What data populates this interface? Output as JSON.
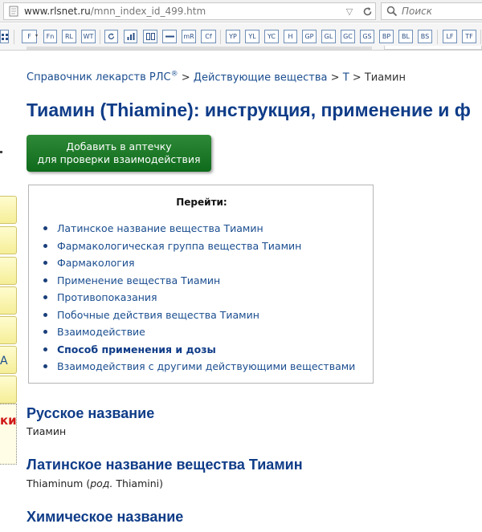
{
  "browser": {
    "url_domain": "www.rlsnet.ru",
    "url_path": "/mnn_index_id_499.htm",
    "search_placeholder": "Поиск"
  },
  "toolbar": {
    "buttons": [
      "F",
      "Fn",
      "RL",
      "WT",
      "",
      "",
      "",
      "mR",
      "Cf",
      "YP",
      "YL",
      "YC",
      "H",
      "GP",
      "GL",
      "GC",
      "GS",
      "BP",
      "BL",
      "BS",
      "LF",
      "TF"
    ]
  },
  "breadcrumb": {
    "root": "Справочник лекарств РЛС",
    "root_sup": "®",
    "sep": ">",
    "section": "Действующие вещества",
    "letter": "Т",
    "current": "Тиамин"
  },
  "page_title": "Тиамин (Thiamine): инструкция, применение и ф",
  "add_button": {
    "line1": "Добавить в аптечку",
    "line2": "для проверки взаимодействия"
  },
  "goto": {
    "title": "Перейти:",
    "items": [
      "Латинское название вещества Тиамин",
      "Фармакологическая группа вещества Тиамин",
      "Фармакология",
      "Применение вещества Тиамин",
      "Противопоказания",
      "Побочные действия вещества Тиамин",
      "Взаимодействие",
      "Способ применения и дозы",
      "Взаимодействия с другими действующими веществами"
    ]
  },
  "sections": {
    "russian_name_heading": "Русское название",
    "russian_name_value": "Тиамин",
    "latin_name_heading": "Латинское название вещества Тиамин",
    "latin_name_value": "Thiaminum (",
    "latin_name_genitive_label": "род.",
    "latin_name_genitive_value": " Thiamini)",
    "chemical_name_heading": "Химическое название"
  },
  "sidebar": {
    "letter_a": "А",
    "red_text": "ки"
  }
}
